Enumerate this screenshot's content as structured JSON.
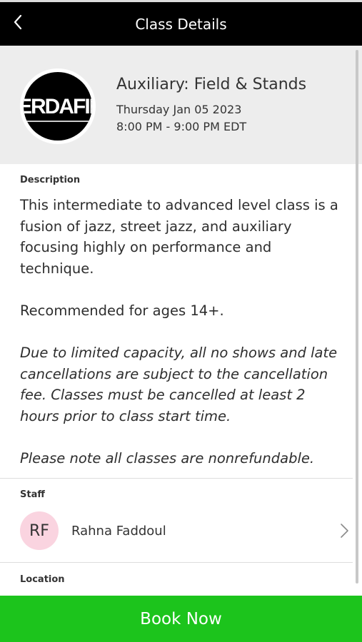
{
  "header": {
    "title": "Class Details",
    "back_icon": "chevron-left-icon"
  },
  "class": {
    "logo_text": "ERDAFIE",
    "title": "Auxiliary: Field & Stands",
    "date": "Thursday Jan 05 2023",
    "time": "8:00 PM - 9:00 PM EDT"
  },
  "description": {
    "label": "Description",
    "paragraph1": "This intermediate to advanced level class is a fusion of jazz, street jazz, and auxiliary focusing highly on performance and technique.",
    "paragraph2": "Recommended for ages 14+.",
    "paragraph3": "Due to limited capacity, all no shows and late cancellations are subject to the cancellation fee. Classes must be cancelled at least 2 hours prior to class start time.",
    "paragraph4": "Please note all classes are nonrefundable."
  },
  "staff": {
    "label": "Staff",
    "initials": "RF",
    "name": "Rahna Faddoul",
    "avatar_color": "#fad4e0"
  },
  "location": {
    "label": "Location"
  },
  "book": {
    "label": "Book Now",
    "color": "#1cc41c"
  }
}
